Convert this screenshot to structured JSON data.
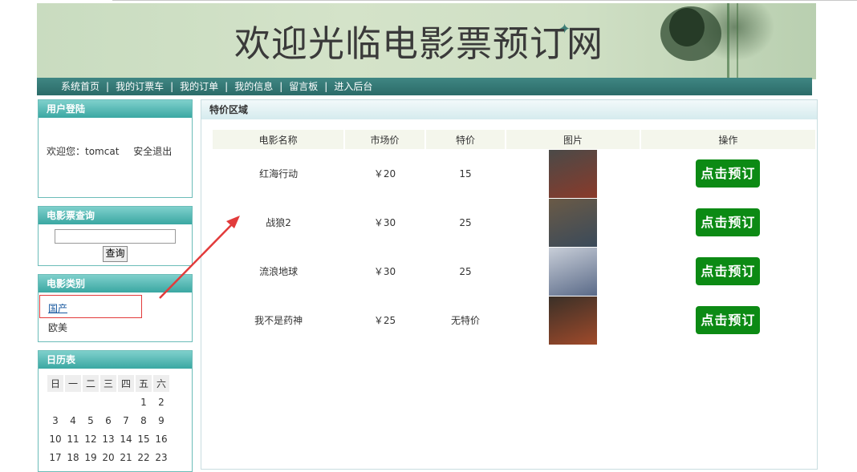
{
  "banner": {
    "title": "欢迎光临电影票预订网"
  },
  "nav": {
    "items": [
      "系统首页",
      "我的订票车",
      "我的订单",
      "我的信息",
      "留言板",
      "进入后台"
    ],
    "separator": "|"
  },
  "login": {
    "title": "用户登陆",
    "welcome": "欢迎您：tomcat",
    "logout": "安全退出"
  },
  "search": {
    "title": "电影票查询",
    "input_value": "",
    "button": "查询"
  },
  "categories": {
    "title": "电影类别",
    "items": [
      "国产",
      "欧美"
    ]
  },
  "calendar": {
    "title": "日历表",
    "weekdays": [
      "日",
      "一",
      "二",
      "三",
      "四",
      "五",
      "六"
    ],
    "rows": [
      [
        "",
        "",
        "",
        "",
        "",
        "1",
        "2"
      ],
      [
        "3",
        "4",
        "5",
        "6",
        "7",
        "8",
        "9"
      ],
      [
        "10",
        "11",
        "12",
        "13",
        "14",
        "15",
        "16"
      ],
      [
        "17",
        "18",
        "19",
        "20",
        "21",
        "22",
        "23"
      ]
    ]
  },
  "main": {
    "title": "特价区域",
    "columns": [
      "电影名称",
      "市场价",
      "特价",
      "图片",
      "操作"
    ],
    "rows": [
      {
        "name": "红海行动",
        "market_price": "￥20",
        "special": "15",
        "action": "点击预订",
        "poster_colors": [
          "#4a4a48",
          "#8a3a2a"
        ]
      },
      {
        "name": "战狼2",
        "market_price": "￥30",
        "special": "25",
        "action": "点击预订",
        "poster_colors": [
          "#6a5a46",
          "#3a4a5a"
        ]
      },
      {
        "name": "流浪地球",
        "market_price": "￥30",
        "special": "25",
        "action": "点击预订",
        "poster_colors": [
          "#c8ced8",
          "#5a6a88"
        ]
      },
      {
        "name": "我不是药神",
        "market_price": "￥25",
        "special": "无特价",
        "action": "点击预订",
        "poster_colors": [
          "#3a3028",
          "#a04a2a"
        ]
      }
    ]
  },
  "colors": {
    "nav": "#2f7270",
    "box_head": "#3aa7a2",
    "book_button": "#0c8a14",
    "annotation": "#e23b3b"
  }
}
